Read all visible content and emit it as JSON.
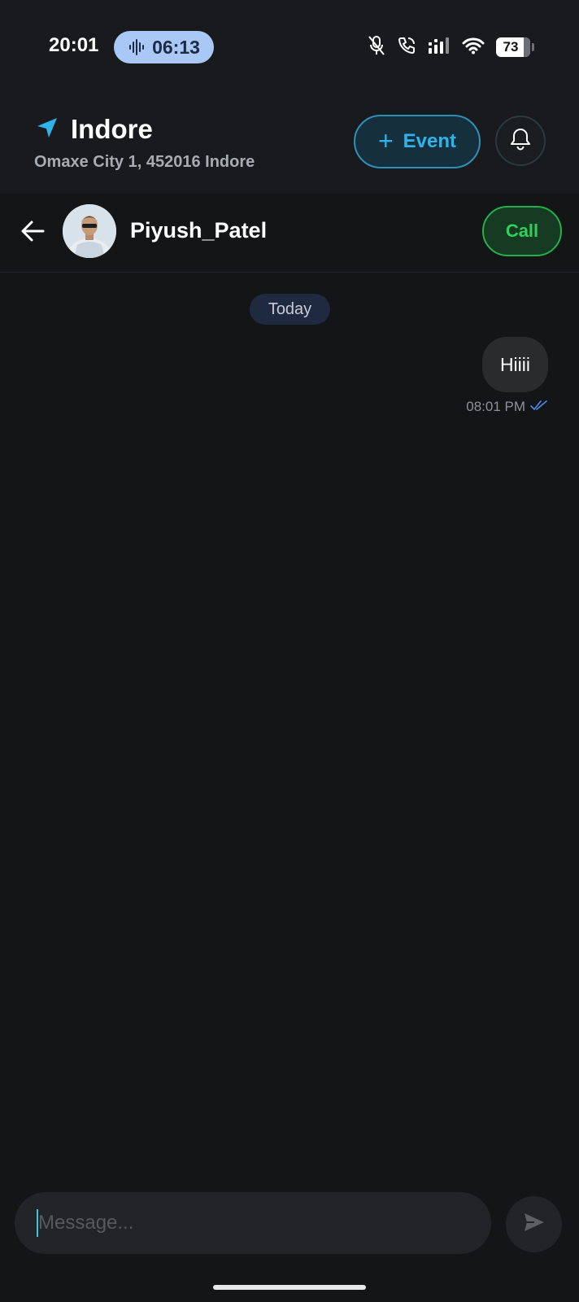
{
  "status_bar": {
    "time": "20:01",
    "recording_time": "06:13",
    "battery": "73",
    "icons": [
      "sound-wave-icon",
      "mic-muted-icon",
      "wifi-calling-icon",
      "signal-icon",
      "wifi-icon",
      "battery-icon"
    ]
  },
  "location": {
    "city": "Indore",
    "address": "Omaxe City 1, 452016 Indore",
    "icon": "navigation-arrow-icon"
  },
  "actions": {
    "event_label": "Event",
    "event_icon": "plus-icon",
    "notifications_icon": "bell-icon"
  },
  "chat": {
    "contact_name": "Piyush_Patel",
    "call_label": "Call",
    "date_separator": "Today",
    "messages": [
      {
        "text": "Hiiii",
        "time": "08:01 PM",
        "status": "read",
        "outgoing": true
      }
    ]
  },
  "composer": {
    "placeholder": "Message...",
    "value": "",
    "send_icon": "send-icon"
  },
  "colors": {
    "background": "#141516",
    "header": "#181a1d",
    "accent_blue": "#2eb4ea",
    "call_green": "#2fd15c",
    "bubble": "#2a2b2d",
    "date_pill": "#1f2940"
  }
}
